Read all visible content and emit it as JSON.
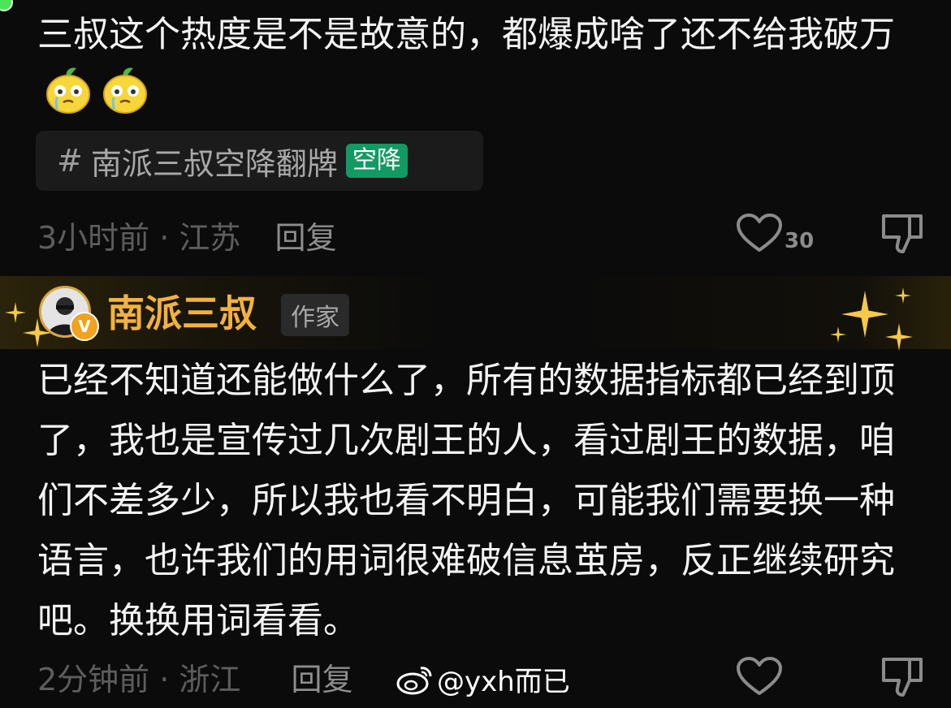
{
  "comment1": {
    "text": "三叔这个热度是不是故意的，都爆成啥了还不给我破万",
    "emoji": "crying-lemon",
    "topic": {
      "hash": "#",
      "label": "南派三叔空降翻牌",
      "badge": "空降"
    },
    "meta": {
      "time_location": "3小时前 · 江苏",
      "reply": "回复"
    },
    "likes": "30"
  },
  "comment2": {
    "author": "南派三叔",
    "verified": "V",
    "role": "作家",
    "text": "已经不知道还能做什么了，所有的数据指标都已经到顶了，我也是宣传过几次剧王的人，看过剧王的数据，咱们不差多少，所以我也看不明白，可能我们需要换一种语言，也许我们的用词很难破信息茧房，反正继续研究吧。换换用词看看。",
    "meta": {
      "time_location": "2分钟前 · 浙江",
      "reply": "回复"
    }
  },
  "watermark": {
    "text": "@yxh而已"
  },
  "colors": {
    "background": "#0b0b0b",
    "author_name": "#f2b23c",
    "topic_badge": "#119a62",
    "online_dot": "#4fe35a"
  }
}
